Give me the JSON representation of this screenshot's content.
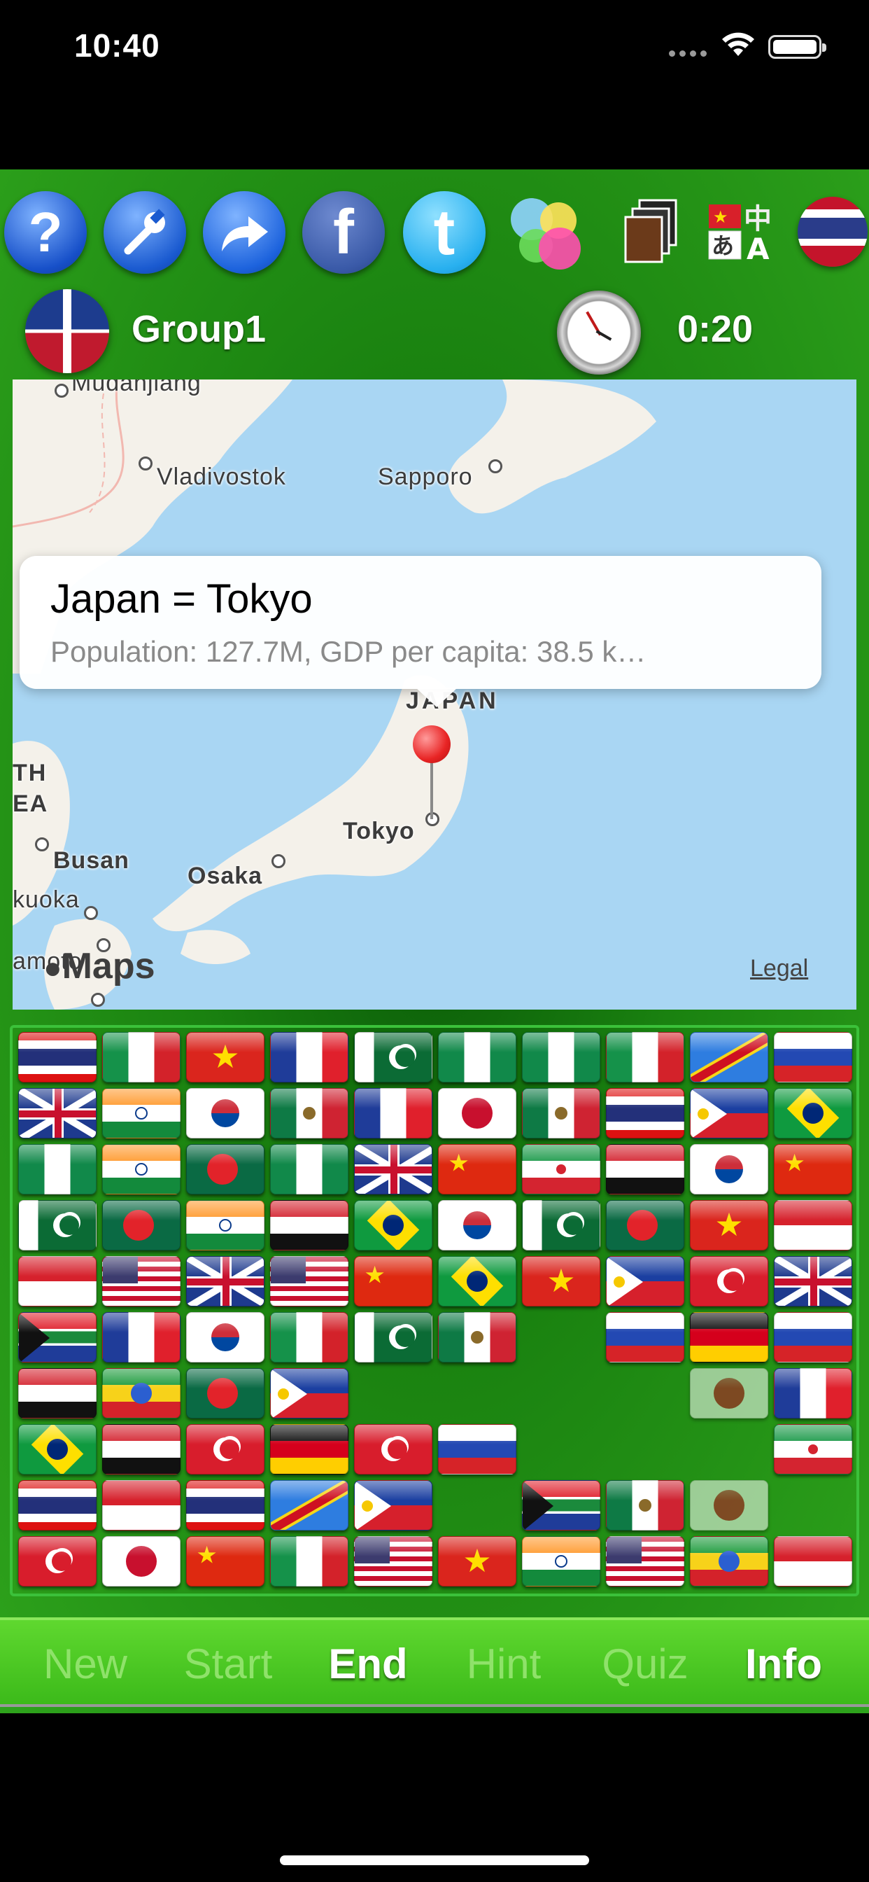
{
  "status_bar": {
    "time": "10:40"
  },
  "toolbar": {
    "icons": [
      "help-icon",
      "settings-wrench-icon",
      "share-icon",
      "facebook-icon",
      "twitter-icon",
      "game-center-icon",
      "cards-icon",
      "language-icon",
      "flag-globe-icon"
    ],
    "help_glyph": "?",
    "facebook_glyph": "f",
    "twitter_glyph": "t"
  },
  "header": {
    "group_name": "Group1",
    "timer": "0:20"
  },
  "map": {
    "labels": {
      "vladivostok": "Vladivostok",
      "sapporo": "Sapporo",
      "japan": "JAPAN",
      "tokyo": "Tokyo",
      "busan": "Busan",
      "osaka": "Osaka",
      "fukuoka": "kuoka",
      "kumamoto": "amoto",
      "mudanjiang": "Mudanjiang",
      "north_korea": "TH EA"
    },
    "callout": {
      "title": "Japan = Tokyo",
      "subtitle": "Population: 127.7M, GDP per capita: 38.5 k…"
    },
    "brand": "Maps",
    "legal": "Legal"
  },
  "board": {
    "rows": [
      [
        "thailand",
        "italy",
        "vietnam",
        "france",
        "pakistan",
        "nigeria",
        "nigeria",
        "italy",
        "congo",
        "russia"
      ],
      [
        "uk",
        "india",
        "south-korea",
        "mexico",
        "france",
        "japan",
        "mexico",
        "thailand",
        "philippines",
        "brazil"
      ],
      [
        "nigeria",
        "india",
        "bangladesh",
        "nigeria",
        "uk",
        "china",
        "iran",
        "egypt",
        "south-korea",
        "china"
      ],
      [
        "pakistan",
        "bangladesh",
        "india",
        "egypt",
        "brazil",
        "south-korea",
        "pakistan",
        "bangladesh",
        "vietnam",
        "indonesia"
      ],
      [
        "indonesia",
        "usa",
        "uk",
        "usa",
        "china",
        "brazil",
        "vietnam",
        "philippines",
        "turkey",
        "uk"
      ],
      [
        "south-africa",
        "france",
        "south-korea",
        "italy",
        "pakistan",
        "mexico",
        null,
        "russia",
        "germany",
        "russia"
      ],
      [
        "egypt",
        "ethiopia",
        "bangladesh",
        "philippines",
        null,
        null,
        null,
        null,
        "japan-dim",
        "france"
      ],
      [
        "brazil",
        "egypt",
        "turkey",
        "germany",
        "turkey",
        "russia",
        null,
        null,
        null,
        "iran"
      ],
      [
        "thailand",
        "indonesia",
        "thailand",
        "congo",
        "philippines",
        null,
        "south-africa",
        "mexico",
        "japan-dim",
        null
      ],
      [
        "turkey",
        "japan",
        "china",
        "italy",
        "usa",
        "vietnam",
        "india",
        "usa",
        "ethiopia",
        "indonesia"
      ]
    ]
  },
  "bottom_bar": {
    "new": "New",
    "start": "Start",
    "end": "End",
    "hint": "Hint",
    "quiz": "Quiz",
    "info": "Info"
  }
}
